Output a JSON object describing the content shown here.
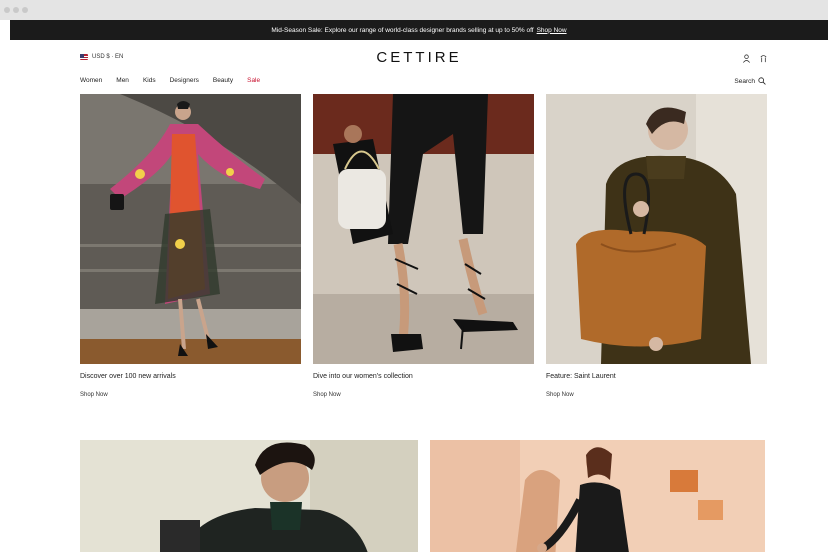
{
  "promo_bar": {
    "message": "Mid-Season Sale: Explore our range of world-class designer brands selling at up to 50% off",
    "link": "Shop Now"
  },
  "header": {
    "locale": "USD $  ·  EN",
    "logo": "CETTIRE",
    "nav": [
      "Women",
      "Men",
      "Kids",
      "Designers",
      "Beauty",
      "Sale"
    ],
    "search": "Search"
  },
  "tiles": [
    {
      "caption": "Discover over 100 new arrivals",
      "cta": "Shop Now"
    },
    {
      "caption": "Dive into our women's collection",
      "cta": "Shop Now"
    },
    {
      "caption": "Feature: Saint Laurent",
      "cta": "Shop Now"
    }
  ],
  "colors": {
    "sale": "#c8102e",
    "promo_bg": "#1b1b1b"
  }
}
